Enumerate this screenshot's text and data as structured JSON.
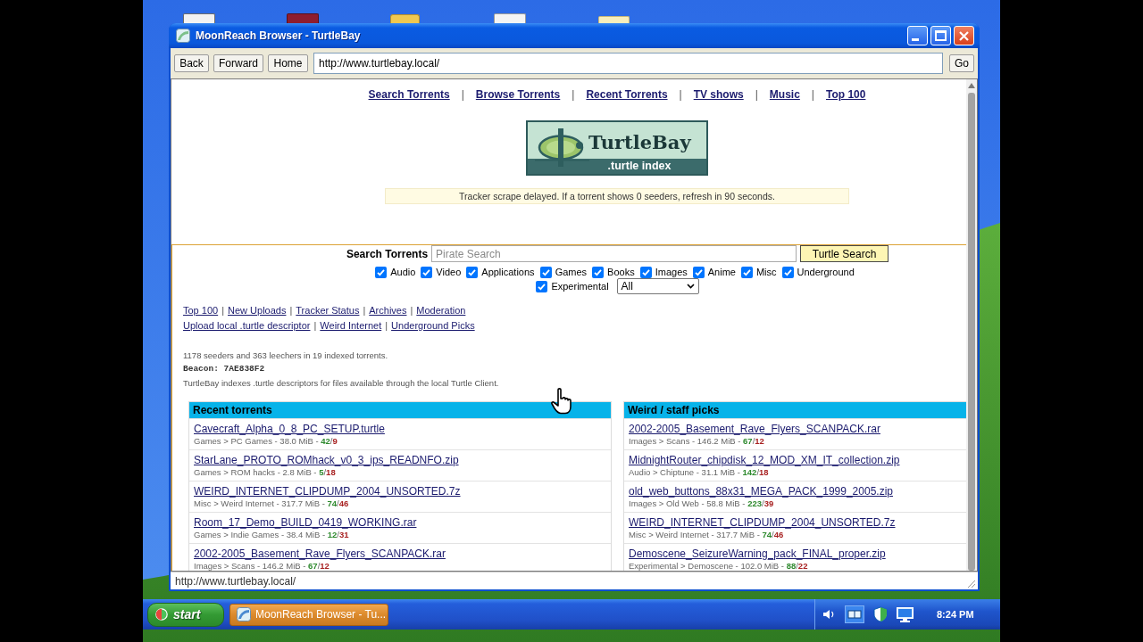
{
  "window": {
    "title": "MoonReach Browser - TurtleBay"
  },
  "toolbar": {
    "buttons": [
      "Back",
      "Forward",
      "Home"
    ],
    "address": "http://www.turtlebay.local/",
    "go": "Go"
  },
  "page": {
    "nav": [
      {
        "kind": "link",
        "text": "Search Torrents"
      },
      {
        "kind": "separator",
        "text": "|"
      },
      {
        "kind": "link",
        "text": "Browse Torrents"
      },
      {
        "kind": "separator",
        "text": "|"
      },
      {
        "kind": "link",
        "text": "Recent Torrents"
      },
      {
        "kind": "separator",
        "text": "|"
      },
      {
        "kind": "link",
        "text": "TV shows"
      },
      {
        "kind": "separator",
        "text": "|"
      },
      {
        "kind": "link",
        "text": "Music"
      },
      {
        "kind": "separator",
        "text": "|"
      },
      {
        "kind": "link",
        "text": "Top 100"
      }
    ],
    "logo": {
      "title": "TurtleBay",
      "subtitle": ".turtle index"
    },
    "notice": "Tracker scrape delayed. If a torrent shows 0 seeders, refresh in 90 seconds.",
    "search": {
      "label": "Search Torrents",
      "placeholder": "Pirate Search",
      "button": "Turtle Search",
      "categories": [
        {
          "label": "Audio",
          "checked": true
        },
        {
          "label": "Video",
          "checked": true
        },
        {
          "label": "Applications",
          "checked": true
        },
        {
          "label": "Games",
          "checked": true
        },
        {
          "label": "Books",
          "checked": true
        },
        {
          "label": "Images",
          "checked": true
        },
        {
          "label": "Anime",
          "checked": true
        },
        {
          "label": "Misc",
          "checked": true
        },
        {
          "label": "Underground",
          "checked": true
        },
        {
          "label": "Experimental",
          "checked": true
        }
      ],
      "filter": {
        "value": "All"
      }
    },
    "quick_links": [
      {
        "items": [
          {
            "kind": "link",
            "text": "Top 100"
          },
          {
            "kind": "separator",
            "text": "|"
          },
          {
            "kind": "link",
            "text": "New Uploads"
          },
          {
            "kind": "separator",
            "text": "|"
          },
          {
            "kind": "link",
            "text": "Tracker Status"
          },
          {
            "kind": "separator",
            "text": "|"
          },
          {
            "kind": "link",
            "text": "Archives"
          },
          {
            "kind": "separator",
            "text": "|"
          },
          {
            "kind": "link",
            "text": "Moderation"
          }
        ]
      },
      {
        "items": [
          {
            "kind": "link",
            "text": "Upload local .turtle descriptor"
          },
          {
            "kind": "separator",
            "text": "|"
          },
          {
            "kind": "link",
            "text": "Weird Internet"
          },
          {
            "kind": "separator",
            "text": "|"
          },
          {
            "kind": "link",
            "text": "Underground Picks"
          }
        ]
      }
    ],
    "stats": "1178 seeders and 363 leechers in 19 indexed torrents.",
    "beacon": "Beacon: 7AE838F2",
    "about": "TurtleBay indexes .turtle descriptors for files available through the local Turtle Client.",
    "panels": [
      {
        "title": "Recent torrents",
        "torrents": [
          {
            "name": "Cavecraft_Alpha_0_8_PC_SETUP.turtle",
            "details": "Games > PC Games - 38.0 MiB -",
            "seeders": "42",
            "separator": "/",
            "leechers": "9"
          },
          {
            "name": "StarLane_PROTO_ROMhack_v0_3_ips_READNFO.zip",
            "details": "Games > ROM hacks - 2.8 MiB -",
            "seeders": "5",
            "separator": "/",
            "leechers": "18"
          },
          {
            "name": "WEIRD_INTERNET_CLIPDUMP_2004_UNSORTED.7z",
            "details": "Misc > Weird Internet - 317.7 MiB -",
            "seeders": "74",
            "separator": "/",
            "leechers": "46"
          },
          {
            "name": "Room_17_Demo_BUILD_0419_WORKING.rar",
            "details": "Games > Indie Games - 38.4 MiB -",
            "seeders": "12",
            "separator": "/",
            "leechers": "31"
          },
          {
            "name": "2002-2005_Basement_Rave_Flyers_SCANPACK.rar",
            "details": "Images > Scans - 146.2 MiB -",
            "seeders": "67",
            "separator": "/",
            "leechers": "12"
          }
        ]
      },
      {
        "title": "Weird / staff picks",
        "torrents": [
          {
            "name": "2002-2005_Basement_Rave_Flyers_SCANPACK.rar",
            "details": "Images > Scans - 146.2 MiB -",
            "seeders": "67",
            "separator": "/",
            "leechers": "12"
          },
          {
            "name": "MidnightRouter_chipdisk_12_MOD_XM_IT_collection.zip",
            "details": "Audio > Chiptune - 31.1 MiB -",
            "seeders": "142",
            "separator": "/",
            "leechers": "18"
          },
          {
            "name": "old_web_buttons_88x31_MEGA_PACK_1999_2005.zip",
            "details": "Images > Old Web - 58.8 MiB -",
            "seeders": "223",
            "separator": "/",
            "leechers": "39"
          },
          {
            "name": "WEIRD_INTERNET_CLIPDUMP_2004_UNSORTED.7z",
            "details": "Misc > Weird Internet - 317.7 MiB -",
            "seeders": "74",
            "separator": "/",
            "leechers": "46"
          },
          {
            "name": "Demoscene_SeizureWarning_pack_FINAL_proper.zip",
            "details": "Experimental > Demoscene - 102.0 MiB -",
            "seeders": "88",
            "separator": "/",
            "leechers": "22"
          }
        ]
      }
    ]
  },
  "status_bar": {
    "text": "http://www.turtlebay.local/"
  },
  "taskbar": {
    "start": "start",
    "tasks": [
      {
        "label": "MoonReach Browser - Tu...",
        "selected": true
      }
    ],
    "clock": "8:24 PM"
  }
}
